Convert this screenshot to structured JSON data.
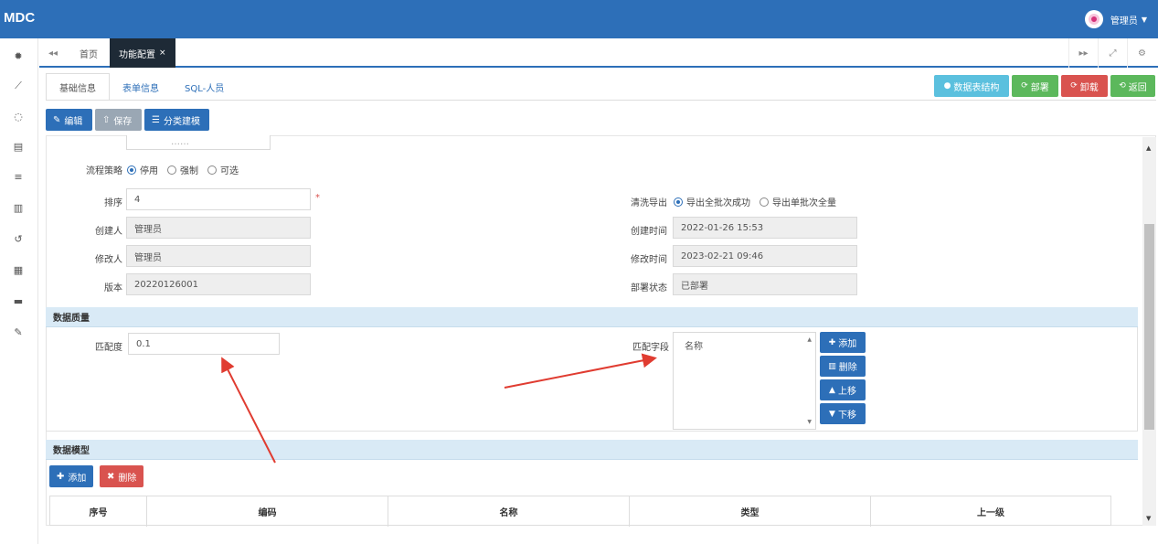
{
  "app": {
    "logo": "MDC",
    "user": "管理员"
  },
  "sidebar": {
    "icons": [
      "dashboard-icon",
      "chart-icon",
      "loading-icon",
      "database-icon",
      "list-icon",
      "columns-icon",
      "history-icon",
      "film-icon",
      "archive-icon",
      "wrench-icon"
    ]
  },
  "tabs": {
    "items": [
      {
        "label": "首页"
      },
      {
        "label": "功能配置"
      }
    ],
    "close_glyph": "×"
  },
  "subtabs": [
    {
      "label": "基础信息"
    },
    {
      "label": "表单信息"
    },
    {
      "label": "SQL-人员"
    }
  ],
  "top_actions": {
    "table_structure": "数据表结构",
    "deploy": "部署",
    "undeploy": "卸载",
    "back": "返回",
    "colors": {
      "info": "#5bc0de",
      "success": "#5cb85c",
      "danger": "#d9534f"
    }
  },
  "actions": {
    "edit": "编辑",
    "save": "保存",
    "model": "分类建模"
  },
  "form": {
    "partial_value": "……",
    "strategy": {
      "label": "流程策略",
      "options": [
        "停用",
        "强制",
        "可选"
      ],
      "selected": 0
    },
    "sort": {
      "label": "排序",
      "value": "4",
      "required": "*"
    },
    "clean_export": {
      "label": "清洗导出",
      "options": [
        "导出全批次成功",
        "导出单批次全量"
      ],
      "selected": 0
    },
    "creator": {
      "label": "创建人",
      "value": "管理员"
    },
    "created_time": {
      "label": "创建时间",
      "value": "2022-01-26 15:53"
    },
    "modifier": {
      "label": "修改人",
      "value": "管理员"
    },
    "modified_time": {
      "label": "修改时间",
      "value": "2023-02-21 09:46"
    },
    "version": {
      "label": "版本",
      "value": "20220126001"
    },
    "deploy_status": {
      "label": "部署状态",
      "value": "已部署"
    }
  },
  "quality": {
    "title": "数据质量",
    "match_degree": {
      "label": "匹配度",
      "value": "0.1"
    },
    "match_field": {
      "label": "匹配字段",
      "items": [
        "名称"
      ]
    },
    "buttons": {
      "add": "添加",
      "delete": "删除",
      "up": "上移",
      "down": "下移"
    }
  },
  "model": {
    "title": "数据模型",
    "add": "添加",
    "delete": "删除",
    "columns": [
      "序号",
      "编码",
      "名称",
      "类型",
      "上一级"
    ]
  },
  "colors": {
    "primary": "#2d6fb8",
    "header": "#2d6fb8",
    "active_tab": "#1e2a36",
    "section": "#d9eaf6",
    "annotation_arrow": "#e03c31"
  }
}
